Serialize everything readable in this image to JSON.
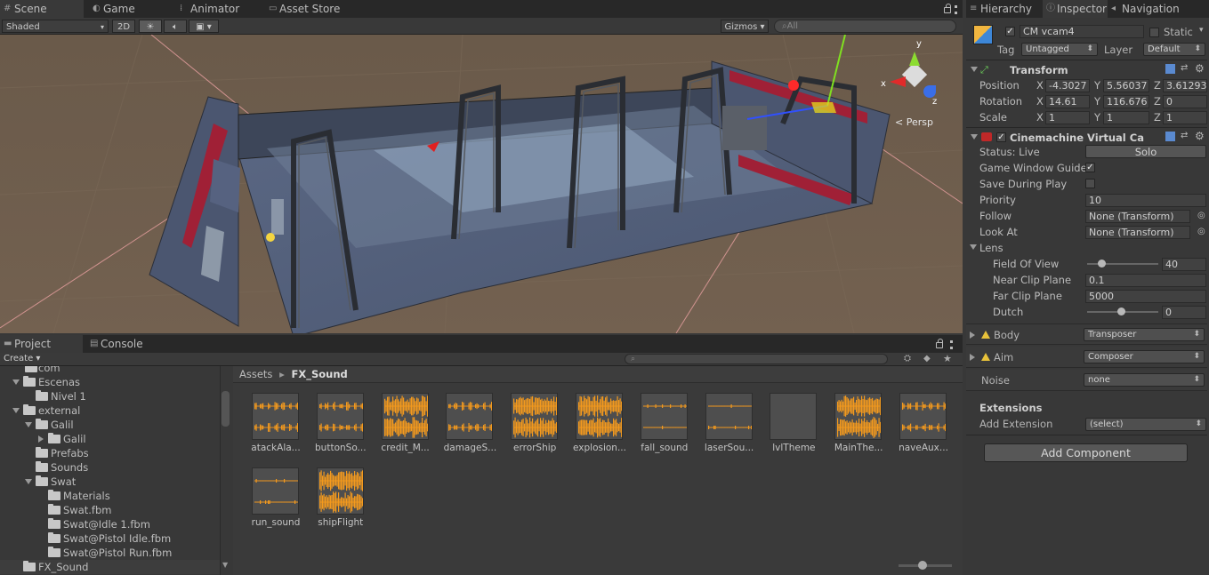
{
  "scene_panel": {
    "tabs": [
      {
        "label": "Scene",
        "icon": "grid-icon"
      },
      {
        "label": "Game",
        "icon": "pacman-icon"
      },
      {
        "label": "Animator",
        "icon": "animator-icon"
      },
      {
        "label": "Asset Store",
        "icon": "store-icon"
      }
    ],
    "toolbar": {
      "shading_mode": "Shaded",
      "mode_2d": "2D",
      "gizmos": "Gizmos",
      "search_placeholder": "All"
    },
    "gizmo": {
      "x_label": "x",
      "y_label": "y",
      "z_label": "z",
      "persp_label": "Persp"
    }
  },
  "project_panel": {
    "tabs": [
      {
        "label": "Project",
        "icon": "folder-icon"
      },
      {
        "label": "Console",
        "icon": "console-icon"
      }
    ],
    "create_label": "Create",
    "tree": [
      {
        "label": "com"
      },
      {
        "label": "Escenas"
      },
      {
        "label": "Nivel 1"
      },
      {
        "label": "external"
      },
      {
        "label": "Galil"
      },
      {
        "label": "Galil"
      },
      {
        "label": "Prefabs"
      },
      {
        "label": "Sounds"
      },
      {
        "label": "Swat"
      },
      {
        "label": "Materials"
      },
      {
        "label": "Swat.fbm"
      },
      {
        "label": "Swat@Idle 1.fbm"
      },
      {
        "label": "Swat@Pistol Idle.fbm"
      },
      {
        "label": "Swat@Pistol Run.fbm"
      },
      {
        "label": "FX_Sound"
      }
    ],
    "breadcrumb": {
      "root": "Assets",
      "separator": "▸",
      "current": "FX_Sound"
    },
    "assets": [
      {
        "name": "atackAla..."
      },
      {
        "name": "buttonSo..."
      },
      {
        "name": "credit_M..."
      },
      {
        "name": "damageS..."
      },
      {
        "name": "errorShip"
      },
      {
        "name": "explosion..."
      },
      {
        "name": "fall_sound"
      },
      {
        "name": "laserSou..."
      },
      {
        "name": "lvlTheme"
      },
      {
        "name": "MainThe..."
      },
      {
        "name": "naveAux..."
      },
      {
        "name": "run_sound"
      },
      {
        "name": "shipFlight"
      }
    ]
  },
  "right_panel": {
    "tabs": [
      {
        "label": "Hierarchy"
      },
      {
        "label": "Inspector"
      },
      {
        "label": "Navigation"
      }
    ],
    "object": {
      "name": "CM vcam4",
      "static_label": "Static",
      "tag_label": "Tag",
      "tag_value": "Untagged",
      "layer_label": "Layer",
      "layer_value": "Default"
    },
    "transform": {
      "title": "Transform",
      "position": {
        "label": "Position",
        "x": "-4.3027",
        "y": "5.56037",
        "z": "3.61293"
      },
      "rotation": {
        "label": "Rotation",
        "x": "14.61",
        "y": "116.676",
        "z": "0"
      },
      "scale": {
        "label": "Scale",
        "x": "1",
        "y": "1",
        "z": "1"
      },
      "axis_x": "X",
      "axis_y": "Y",
      "axis_z": "Z"
    },
    "cinemachine": {
      "title": "Cinemachine Virtual Ca",
      "status_label": "Status: Live",
      "solo_label": "Solo",
      "game_window_guides": "Game Window Guide",
      "save_during_play": "Save During Play",
      "priority_label": "Priority",
      "priority_value": "10",
      "follow_label": "Follow",
      "follow_value": "None (Transform)",
      "look_at_label": "Look At",
      "look_at_value": "None (Transform)",
      "lens_label": "Lens",
      "fov_label": "Field Of View",
      "fov_value": "40",
      "near_label": "Near Clip Plane",
      "near_value": "0.1",
      "far_label": "Far Clip Plane",
      "far_value": "5000",
      "dutch_label": "Dutch",
      "dutch_value": "0",
      "body_label": "Body",
      "body_value": "Transposer",
      "aim_label": "Aim",
      "aim_value": "Composer",
      "noise_label": "Noise",
      "noise_value": "none",
      "extensions_label": "Extensions",
      "add_extension_label": "Add Extension",
      "add_extension_value": "(select)"
    },
    "add_component_label": "Add Component"
  }
}
